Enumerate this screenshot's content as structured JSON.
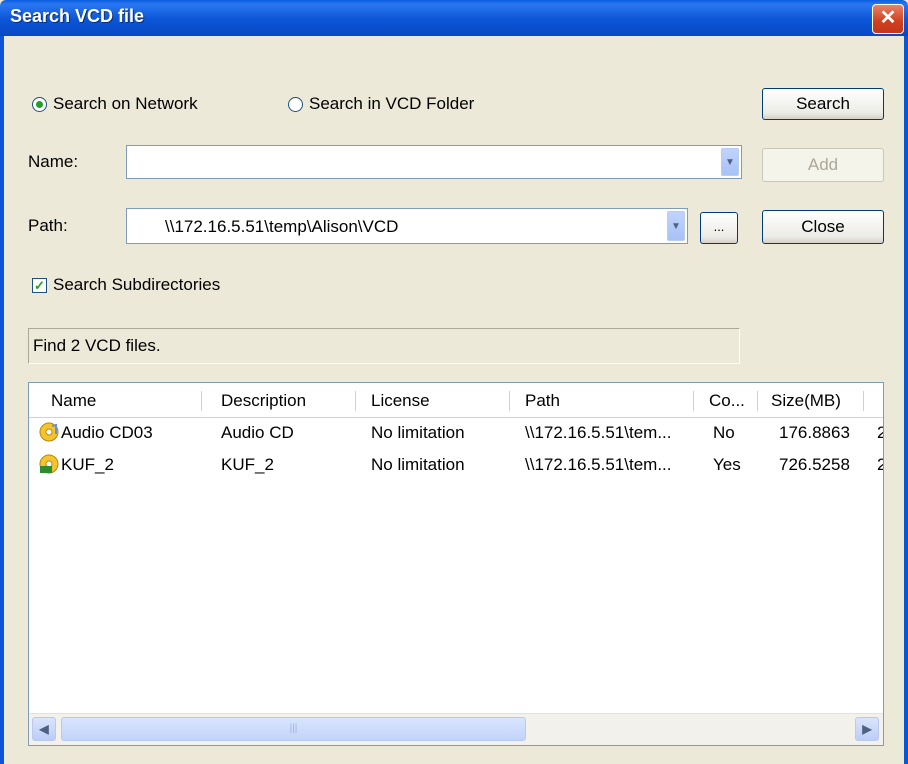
{
  "window": {
    "title": "Search VCD file",
    "close_glyph": "✕"
  },
  "options": {
    "radio_network": {
      "label": "Search on Network",
      "selected": true
    },
    "radio_folder": {
      "label": "Search in VCD Folder",
      "selected": false
    },
    "search_subdirs": {
      "label": "Search Subdirectories",
      "checked": true
    }
  },
  "fields": {
    "name_label": "Name:",
    "name_value": "",
    "path_label": "Path:",
    "path_value": "\\\\172.16.5.51\\temp\\Alison\\VCD"
  },
  "buttons": {
    "search": "Search",
    "add": "Add",
    "close": "Close",
    "browse": "..."
  },
  "status": "Find 2 VCD files.",
  "table": {
    "columns": [
      "Name",
      "Description",
      "License",
      "Path",
      "Co...",
      "Size(MB)"
    ],
    "rows": [
      {
        "name": "Audio CD03",
        "description": "Audio CD",
        "license": "No limitation",
        "path": "\\\\172.16.5.51\\tem...",
        "co": "No",
        "size": "176.8863",
        "extra": "2",
        "icon": "audio-cd-icon"
      },
      {
        "name": "KUF_2",
        "description": "KUF_2",
        "license": "No limitation",
        "path": "\\\\172.16.5.51\\tem...",
        "co": "Yes",
        "size": "726.5258",
        "extra": "2",
        "icon": "vcd-icon"
      }
    ]
  },
  "colors": {
    "title_bar": "#0b55d6",
    "dialog_bg": "#ece9d8",
    "radio_dot": "#21a121"
  }
}
